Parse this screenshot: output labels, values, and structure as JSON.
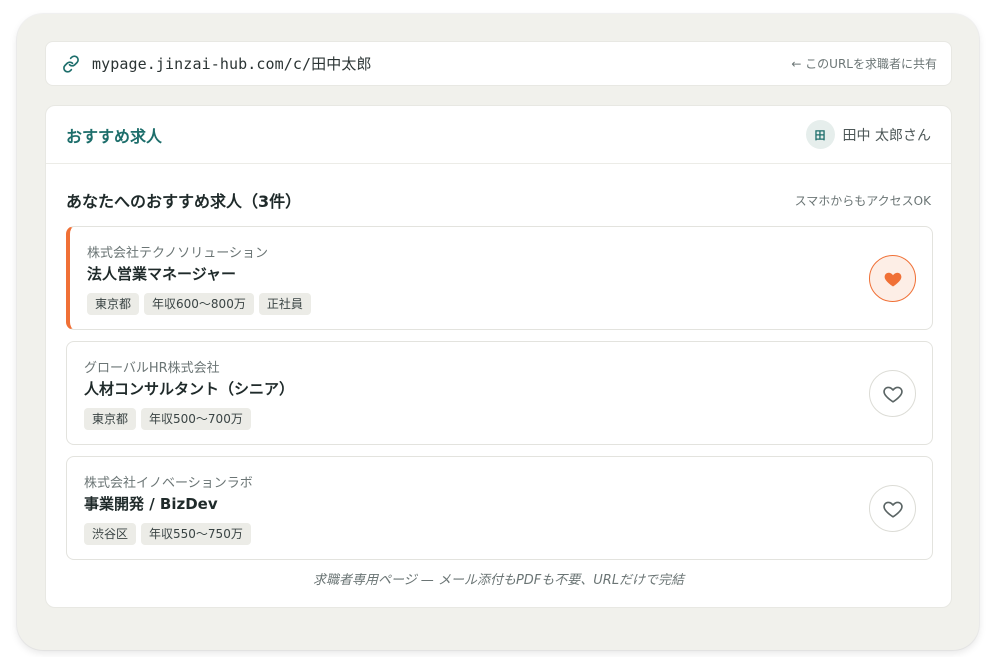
{
  "url_bar": {
    "url": "mypage.jinzai-hub.com/c/田中太郎",
    "hint": "← このURLを求職者に共有"
  },
  "header": {
    "section_title": "おすすめ求人",
    "avatar_initial": "田",
    "user_name": "田中 太郎さん"
  },
  "list": {
    "title": "あなたへのおすすめ求人（3件）",
    "note": "スマホからもアクセスOK"
  },
  "jobs": [
    {
      "company": "株式会社テクノソリューション",
      "title": "法人営業マネージャー",
      "tags": [
        "東京都",
        "年収600〜800万",
        "正社員"
      ],
      "favorited": true
    },
    {
      "company": "グローバルHR株式会社",
      "title": "人材コンサルタント（シニア）",
      "tags": [
        "東京都",
        "年収500〜700万"
      ],
      "favorited": false
    },
    {
      "company": "株式会社イノベーションラボ",
      "title": "事業開発 / BizDev",
      "tags": [
        "渋谷区",
        "年収550〜750万"
      ],
      "favorited": false
    }
  ],
  "footer_note": "求職者専用ページ — メール添付もPDFも不要、URLだけで完結",
  "colors": {
    "accent": "#1d6e6b",
    "favorite": "#f07036"
  }
}
